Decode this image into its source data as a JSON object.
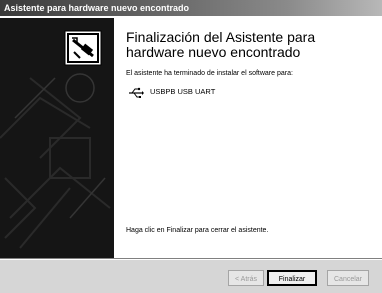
{
  "window": {
    "title": "Asistente para hardware nuevo encontrado"
  },
  "content": {
    "heading": "Finalización del Asistente para hardware nuevo encontrado",
    "intro": "El asistente ha terminado de instalar el software para:",
    "device_name": "USBPB USB UART",
    "device_icon": "usb-icon",
    "footer": "Haga clic en Finalizar para cerrar el asistente."
  },
  "buttons": {
    "back": "< Atrás",
    "finish": "Finalizar",
    "cancel": "Cancelar"
  }
}
